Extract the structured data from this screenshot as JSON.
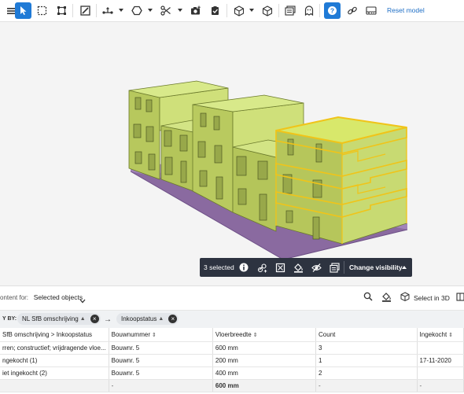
{
  "toolbar": {
    "reset_label": "Reset model"
  },
  "selection_bar": {
    "count_label": "3 selected",
    "change_visibility_label": "Change visibility"
  },
  "panel": {
    "context_label": "ontent for:",
    "context_value": "Selected objects",
    "select_in_3d_label": "Select in 3D",
    "group_by_label": "Y BY:",
    "chip1_label": "NL SfB omschrijving",
    "chip2_label": "Inkoopstatus",
    "columns": [
      "SfB omschrijving > Inkoopstatus",
      "Bouwnummer",
      "Vloerbreedte",
      "Count",
      "Ingekocht"
    ],
    "rows": [
      [
        "rren; constructief; vrijdragende vloe...",
        "Bouwnr. 5",
        "600 mm",
        "3",
        ""
      ],
      [
        "ngekocht (1)",
        "Bouwnr. 5",
        "200 mm",
        "1",
        "17-11-2020"
      ],
      [
        "iet ingekocht (2)",
        "Bouwnr. 5",
        "400 mm",
        "2",
        ""
      ]
    ],
    "footer": [
      "",
      "-",
      "600 mm",
      "-",
      "-"
    ]
  }
}
